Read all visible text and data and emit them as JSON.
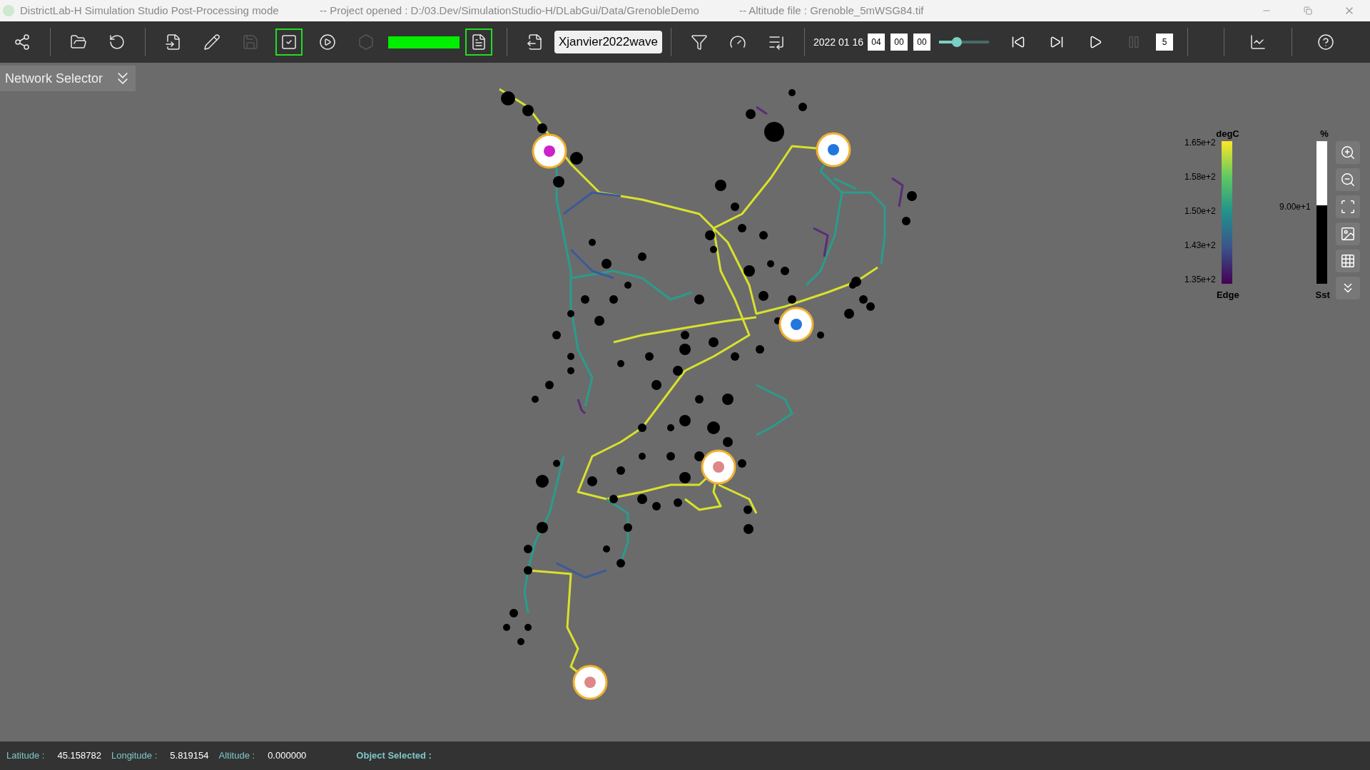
{
  "window": {
    "title": "DistrictLab-H Simulation Studio Post-Processing mode",
    "project": "-- Project opened : D:/03.Dev/SimulationStudio-H/DLabGui/Data/GrenobleDemo",
    "altitude_file": "-- Altitude file : Grenoble_5mWSG84.tif"
  },
  "toolbar": {
    "buttons": [
      {
        "disabled": false,
        "highlighted": false
      },
      {
        "disabled": false,
        "highlighted": false
      },
      {
        "disabled": false,
        "highlighted": false
      },
      {
        "disabled": false,
        "highlighted": false
      },
      {
        "disabled": false,
        "highlighted": false
      },
      {
        "disabled": true,
        "highlighted": false
      },
      {
        "disabled": false,
        "highlighted": true
      },
      {
        "disabled": false,
        "highlighted": false
      },
      {
        "disabled": true,
        "highlighted": false
      }
    ],
    "report_button": {
      "disabled": false,
      "highlighted": true
    },
    "scenario": "Xjanvier2022wave",
    "date": "2022 01 16",
    "hour": "04",
    "minute": "00",
    "second": "00",
    "time_slider": {
      "level": 0.35
    },
    "playback": [
      {
        "disabled": false
      },
      {
        "disabled": false
      },
      {
        "disabled": false
      },
      {
        "disabled": true
      }
    ],
    "step": "5"
  },
  "network_selector": {
    "label": "Network Selector"
  },
  "legend": {
    "edge": {
      "unit": "degC",
      "ticks": [
        "1.65e+2",
        "1.58e+2",
        "1.50e+2",
        "1.43e+2",
        "1.35e+2"
      ],
      "label": "Edge"
    },
    "sst": {
      "unit": "%",
      "ticks": [
        "9.00e+1"
      ],
      "label": "Sst",
      "level": 0.55
    }
  },
  "status_bar": {
    "latitude_label": "Latitude :",
    "latitude": "45.158782",
    "longitude_label": "Longitude :",
    "longitude": "5.819154",
    "altitude_label": "Altitude :",
    "altitude": "0.000000",
    "selection_label": "Object Selected :"
  }
}
